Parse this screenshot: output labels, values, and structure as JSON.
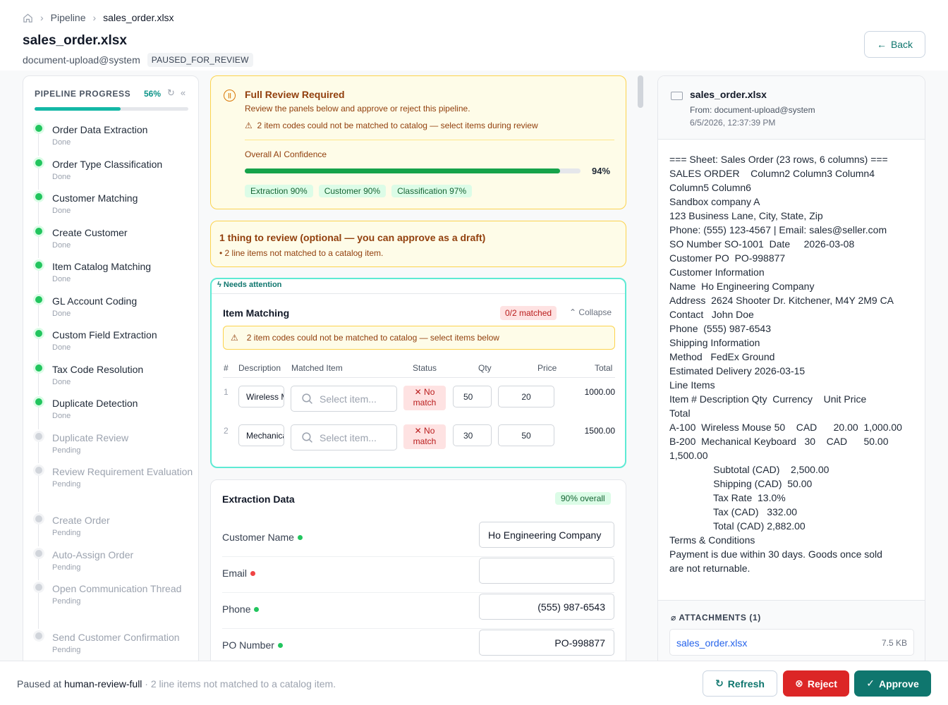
{
  "breadcrumb": {
    "home_icon": "home-icon",
    "items": [
      "Pipeline",
      "sales_order.xlsx"
    ]
  },
  "header": {
    "title": "sales_order.xlsx",
    "source": "document-upload@system",
    "status": "PAUSED_FOR_REVIEW",
    "back_label": "Back"
  },
  "sidebar": {
    "heading": "PIPELINE PROGRESS",
    "percent_label": "56%",
    "progress": 0.56,
    "steps": [
      {
        "name": "Order Data Extraction",
        "status": "Done"
      },
      {
        "name": "Order Type Classification",
        "status": "Done"
      },
      {
        "name": "Customer Matching",
        "status": "Done"
      },
      {
        "name": "Create Customer",
        "status": "Done"
      },
      {
        "name": "Item Catalog Matching",
        "status": "Done"
      },
      {
        "name": "GL Account Coding",
        "status": "Done"
      },
      {
        "name": "Custom Field Extraction",
        "status": "Done"
      },
      {
        "name": "Tax Code Resolution",
        "status": "Done"
      },
      {
        "name": "Duplicate Detection",
        "status": "Done"
      },
      {
        "name": "Duplicate Review",
        "status": "Pending"
      },
      {
        "name": "Review Requirement Evaluation",
        "status": "Pending"
      },
      {
        "name": "Create Order",
        "status": "Pending"
      },
      {
        "name": "Auto-Assign Order",
        "status": "Pending"
      },
      {
        "name": "Open Communication Thread",
        "status": "Pending"
      },
      {
        "name": "Send Customer Confirmation",
        "status": "Pending"
      }
    ]
  },
  "review": {
    "title": "Full Review Required",
    "subtitle": "Review the panels below and approve or reject this pipeline.",
    "warning": "2 item codes could not be matched to catalog — select items during review",
    "confidence_label": "Overall AI Confidence",
    "confidence_value": 0.94,
    "confidence_text": "94%",
    "chips": [
      "Extraction 90%",
      "Customer 90%",
      "Classification 97%"
    ]
  },
  "thing": {
    "title": "1 thing to review (optional — you can approve as a draft)",
    "detail": "• 2 line items not matched to a catalog item."
  },
  "item_matching": {
    "attention": "Needs attention",
    "title": "Item Matching",
    "matched": "0/2 matched",
    "collapse": "Collapse",
    "warning": "2 item codes could not be matched to catalog — select items below",
    "columns": [
      "#",
      "Description",
      "Matched Item",
      "Status",
      "Qty",
      "Price",
      "Total"
    ],
    "select_placeholder": "Select item...",
    "no_match_label": "No match",
    "rows": [
      {
        "num": "1",
        "desc": "Wireless Mouse",
        "qty": "50",
        "price": "20",
        "total": "1000.00"
      },
      {
        "num": "2",
        "desc": "Mechanical Keyboard",
        "qty": "30",
        "price": "50",
        "total": "1500.00"
      }
    ]
  },
  "extraction": {
    "title": "Extraction Data",
    "overall": "90% overall",
    "fields": [
      {
        "label": "Customer Name",
        "value": "Ho Engineering Company",
        "status_color": "#22c55e"
      },
      {
        "label": "Email",
        "value": "",
        "status_color": "#ef4444"
      },
      {
        "label": "Phone",
        "value": "(555) 987-6543",
        "status_color": "#22c55e"
      },
      {
        "label": "PO Number",
        "value": "PO-998877",
        "status_color": "#22c55e"
      }
    ]
  },
  "preview": {
    "filename": "sales_order.xlsx",
    "from": "From: document-upload@system",
    "date": "6/5/2026, 12:37:39 PM",
    "lines": [
      "=== Sheet: Sales Order (23 rows, 6 columns) ===",
      "SALES ORDER    Column2 Column3 Column4",
      "Column5 Column6",
      "Sandbox company A",
      "123 Business Lane, City, State, Zip",
      "Phone: (555) 123-4567 | Email: sales@seller.com",
      "SO Number SO-1001  Date     2026-03-08",
      "Customer PO  PO-998877",
      "Customer Information",
      "Name  Ho Engineering Company",
      "Address  2624 Shooter Dr. Kitchener, M4Y 2M9 CA",
      "Contact   John Doe",
      "Phone  (555) 987-6543",
      "Shipping Information",
      "Method   FedEx Ground",
      "Estimated Delivery 2026-03-15",
      "Line Items",
      "Item # Description Qty  Currency    Unit Price",
      "Total",
      "A-100  Wireless Mouse 50    CAD      20.00  1,000.00",
      "B-200  Mechanical Keyboard   30    CAD      50.00",
      "1,500.00",
      "                Subtotal (CAD)    2,500.00",
      "                Shipping (CAD)  50.00",
      "                Tax Rate  13.0%",
      "                Tax (CAD)   332.00",
      "                Total (CAD) 2,882.00",
      "Terms & Conditions",
      "Payment is due within 30 days. Goods once sold",
      "are not returnable."
    ],
    "attachments_label": "ATTACHMENTS (1)",
    "attachment": {
      "name": "sales_order.xlsx",
      "size": "7.5 KB"
    }
  },
  "footer": {
    "paused_prefix": "Paused at ",
    "step": "human-review-full",
    "note": " · 2 line items not matched to a catalog item.",
    "refresh": "Refresh",
    "reject": "Reject",
    "approve": "Approve"
  }
}
